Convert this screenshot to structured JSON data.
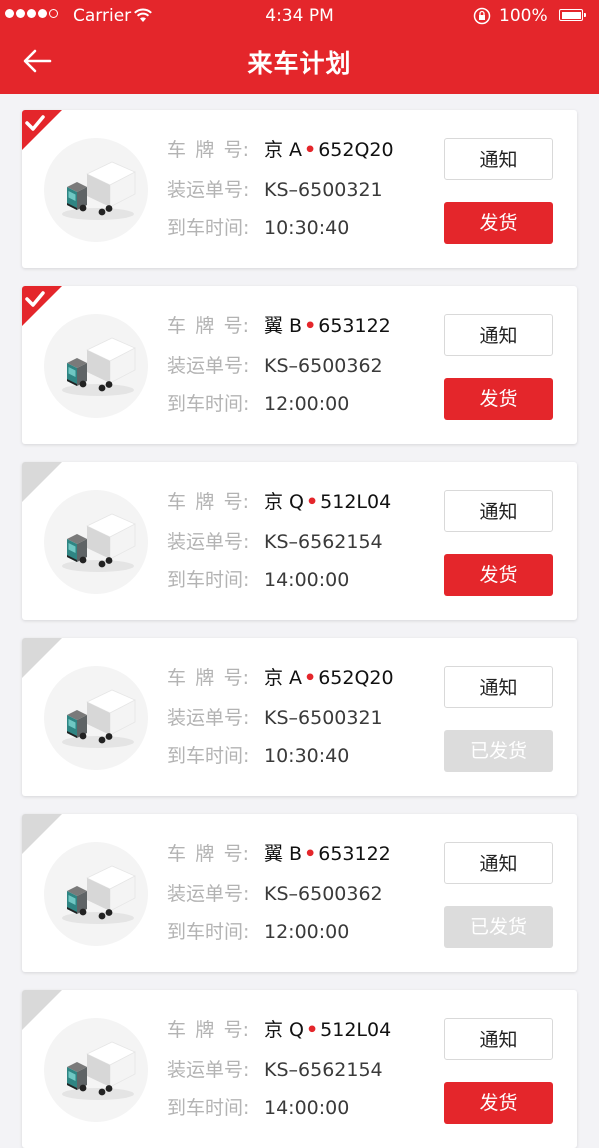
{
  "status_bar": {
    "carrier": "Carrier",
    "time": "4:34 PM",
    "battery": "100%"
  },
  "header": {
    "title": "来车计划",
    "back_icon": "arrow-left-icon",
    "background": "#e4262b"
  },
  "labels": {
    "plate": [
      "车",
      "牌",
      "号:"
    ],
    "shipment": "装运单号:",
    "arrival": "到车时间:"
  },
  "buttons": {
    "notify": "通知",
    "ship": "发货",
    "shipped": "已发货"
  },
  "colors": {
    "accent": "#e4262b",
    "checked_corner": "#e4262b",
    "unchecked_corner": "#d9d9d9",
    "shipped_button": "#dcdcdc"
  },
  "cards": [
    {
      "checked": true,
      "plate_prefix": "京 A",
      "plate_suffix": "652Q20",
      "shipment_no": "KS–6500321",
      "arrival_time": "10:30:40",
      "state": "ship"
    },
    {
      "checked": true,
      "plate_prefix": "翼 B",
      "plate_suffix": "653122",
      "shipment_no": "KS–6500362",
      "arrival_time": "12:00:00",
      "state": "ship"
    },
    {
      "checked": false,
      "plate_prefix": "京 Q",
      "plate_suffix": "512L04",
      "shipment_no": "KS–6562154",
      "arrival_time": "14:00:00",
      "state": "ship"
    },
    {
      "checked": false,
      "plate_prefix": "京 A",
      "plate_suffix": "652Q20",
      "shipment_no": "KS–6500321",
      "arrival_time": "10:30:40",
      "state": "shipped"
    },
    {
      "checked": false,
      "plate_prefix": "翼 B",
      "plate_suffix": "653122",
      "shipment_no": "KS–6500362",
      "arrival_time": "12:00:00",
      "state": "shipped"
    },
    {
      "checked": false,
      "plate_prefix": "京 Q",
      "plate_suffix": "512L04",
      "shipment_no": "KS–6562154",
      "arrival_time": "14:00:00",
      "state": "ship"
    }
  ]
}
